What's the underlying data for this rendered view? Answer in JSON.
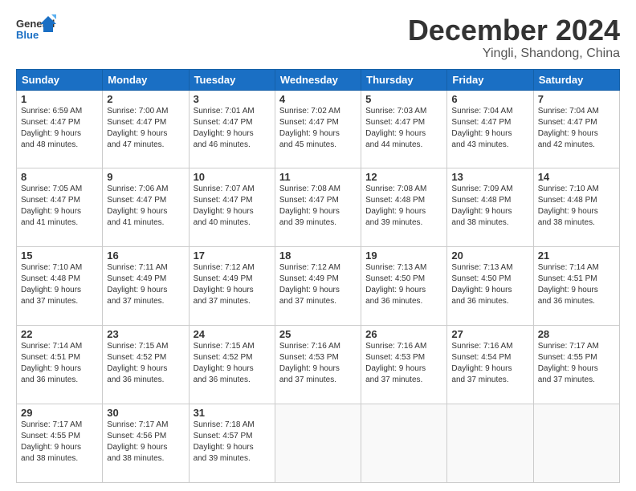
{
  "header": {
    "logo_general": "General",
    "logo_blue": "Blue",
    "main_title": "December 2024",
    "subtitle": "Yingli, Shandong, China"
  },
  "weekdays": [
    "Sunday",
    "Monday",
    "Tuesday",
    "Wednesday",
    "Thursday",
    "Friday",
    "Saturday"
  ],
  "weeks": [
    [
      {
        "day": 1,
        "info": "Sunrise: 6:59 AM\nSunset: 4:47 PM\nDaylight: 9 hours\nand 48 minutes."
      },
      {
        "day": 2,
        "info": "Sunrise: 7:00 AM\nSunset: 4:47 PM\nDaylight: 9 hours\nand 47 minutes."
      },
      {
        "day": 3,
        "info": "Sunrise: 7:01 AM\nSunset: 4:47 PM\nDaylight: 9 hours\nand 46 minutes."
      },
      {
        "day": 4,
        "info": "Sunrise: 7:02 AM\nSunset: 4:47 PM\nDaylight: 9 hours\nand 45 minutes."
      },
      {
        "day": 5,
        "info": "Sunrise: 7:03 AM\nSunset: 4:47 PM\nDaylight: 9 hours\nand 44 minutes."
      },
      {
        "day": 6,
        "info": "Sunrise: 7:04 AM\nSunset: 4:47 PM\nDaylight: 9 hours\nand 43 minutes."
      },
      {
        "day": 7,
        "info": "Sunrise: 7:04 AM\nSunset: 4:47 PM\nDaylight: 9 hours\nand 42 minutes."
      }
    ],
    [
      {
        "day": 8,
        "info": "Sunrise: 7:05 AM\nSunset: 4:47 PM\nDaylight: 9 hours\nand 41 minutes."
      },
      {
        "day": 9,
        "info": "Sunrise: 7:06 AM\nSunset: 4:47 PM\nDaylight: 9 hours\nand 41 minutes."
      },
      {
        "day": 10,
        "info": "Sunrise: 7:07 AM\nSunset: 4:47 PM\nDaylight: 9 hours\nand 40 minutes."
      },
      {
        "day": 11,
        "info": "Sunrise: 7:08 AM\nSunset: 4:47 PM\nDaylight: 9 hours\nand 39 minutes."
      },
      {
        "day": 12,
        "info": "Sunrise: 7:08 AM\nSunset: 4:48 PM\nDaylight: 9 hours\nand 39 minutes."
      },
      {
        "day": 13,
        "info": "Sunrise: 7:09 AM\nSunset: 4:48 PM\nDaylight: 9 hours\nand 38 minutes."
      },
      {
        "day": 14,
        "info": "Sunrise: 7:10 AM\nSunset: 4:48 PM\nDaylight: 9 hours\nand 38 minutes."
      }
    ],
    [
      {
        "day": 15,
        "info": "Sunrise: 7:10 AM\nSunset: 4:48 PM\nDaylight: 9 hours\nand 37 minutes."
      },
      {
        "day": 16,
        "info": "Sunrise: 7:11 AM\nSunset: 4:49 PM\nDaylight: 9 hours\nand 37 minutes."
      },
      {
        "day": 17,
        "info": "Sunrise: 7:12 AM\nSunset: 4:49 PM\nDaylight: 9 hours\nand 37 minutes."
      },
      {
        "day": 18,
        "info": "Sunrise: 7:12 AM\nSunset: 4:49 PM\nDaylight: 9 hours\nand 37 minutes."
      },
      {
        "day": 19,
        "info": "Sunrise: 7:13 AM\nSunset: 4:50 PM\nDaylight: 9 hours\nand 36 minutes."
      },
      {
        "day": 20,
        "info": "Sunrise: 7:13 AM\nSunset: 4:50 PM\nDaylight: 9 hours\nand 36 minutes."
      },
      {
        "day": 21,
        "info": "Sunrise: 7:14 AM\nSunset: 4:51 PM\nDaylight: 9 hours\nand 36 minutes."
      }
    ],
    [
      {
        "day": 22,
        "info": "Sunrise: 7:14 AM\nSunset: 4:51 PM\nDaylight: 9 hours\nand 36 minutes."
      },
      {
        "day": 23,
        "info": "Sunrise: 7:15 AM\nSunset: 4:52 PM\nDaylight: 9 hours\nand 36 minutes."
      },
      {
        "day": 24,
        "info": "Sunrise: 7:15 AM\nSunset: 4:52 PM\nDaylight: 9 hours\nand 36 minutes."
      },
      {
        "day": 25,
        "info": "Sunrise: 7:16 AM\nSunset: 4:53 PM\nDaylight: 9 hours\nand 37 minutes."
      },
      {
        "day": 26,
        "info": "Sunrise: 7:16 AM\nSunset: 4:53 PM\nDaylight: 9 hours\nand 37 minutes."
      },
      {
        "day": 27,
        "info": "Sunrise: 7:16 AM\nSunset: 4:54 PM\nDaylight: 9 hours\nand 37 minutes."
      },
      {
        "day": 28,
        "info": "Sunrise: 7:17 AM\nSunset: 4:55 PM\nDaylight: 9 hours\nand 37 minutes."
      }
    ],
    [
      {
        "day": 29,
        "info": "Sunrise: 7:17 AM\nSunset: 4:55 PM\nDaylight: 9 hours\nand 38 minutes."
      },
      {
        "day": 30,
        "info": "Sunrise: 7:17 AM\nSunset: 4:56 PM\nDaylight: 9 hours\nand 38 minutes."
      },
      {
        "day": 31,
        "info": "Sunrise: 7:18 AM\nSunset: 4:57 PM\nDaylight: 9 hours\nand 39 minutes."
      },
      null,
      null,
      null,
      null
    ]
  ]
}
